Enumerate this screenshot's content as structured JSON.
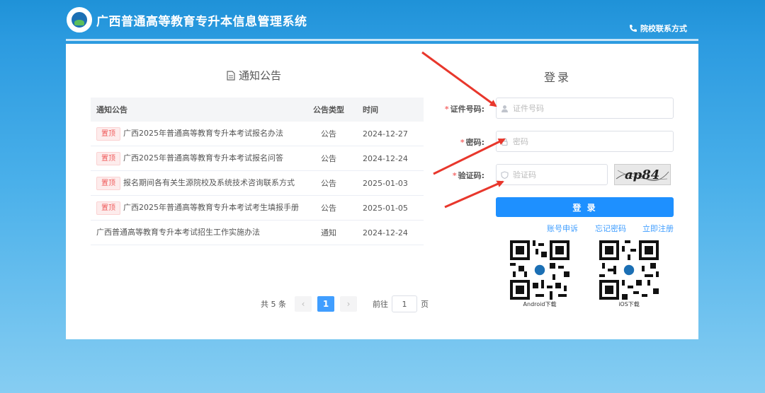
{
  "header": {
    "site_title": "广西普通高等教育专升本信息管理系统",
    "contact_link": "院校联系方式"
  },
  "notice": {
    "title": "通知公告",
    "columns": [
      "通知公告",
      "公告类型",
      "时间"
    ],
    "rows": [
      {
        "pinned": true,
        "tag": "置顶",
        "title": "广西2025年普通高等教育专升本考试报名办法",
        "type": "公告",
        "date": "2024-12-27"
      },
      {
        "pinned": true,
        "tag": "置顶",
        "title": "广西2025年普通高等教育专升本考试报名问答",
        "type": "公告",
        "date": "2024-12-24"
      },
      {
        "pinned": true,
        "tag": "置顶",
        "title": "报名期间各有关生源院校及系统技术咨询联系方式",
        "type": "公告",
        "date": "2025-01-03"
      },
      {
        "pinned": true,
        "tag": "置顶",
        "title": "广西2025年普通高等教育专升本考试考生填报手册",
        "type": "公告",
        "date": "2025-01-05"
      },
      {
        "pinned": false,
        "tag": "",
        "title": "广西普通高等教育专升本考试招生工作实施办法",
        "type": "通知",
        "date": "2024-12-24"
      }
    ],
    "pagination": {
      "total_text": "共 5 条",
      "prev": "‹",
      "current_page": "1",
      "next": "›",
      "goto_prefix": "前往",
      "goto_value": "1",
      "goto_suffix": "页"
    }
  },
  "login": {
    "title": "登录",
    "id_label": "证件号码:",
    "id_placeholder": "证件号码",
    "password_label": "密码:",
    "password_placeholder": "密码",
    "captcha_label": "验证码:",
    "captcha_placeholder": "验证码",
    "captcha_text": "ap84",
    "required_mark": "*",
    "submit_label": "登 录",
    "appeal_link": "账号申诉",
    "forgot_link": "忘记密码",
    "register_link": "立即注册",
    "android_label": "Android下载",
    "ios_label": "iOS下载"
  },
  "colors": {
    "primary": "#1e90ff",
    "header_bg": "#1f92d8",
    "pinned_tag": "#f05c5c",
    "annotation_arrow": "#e8372c"
  }
}
